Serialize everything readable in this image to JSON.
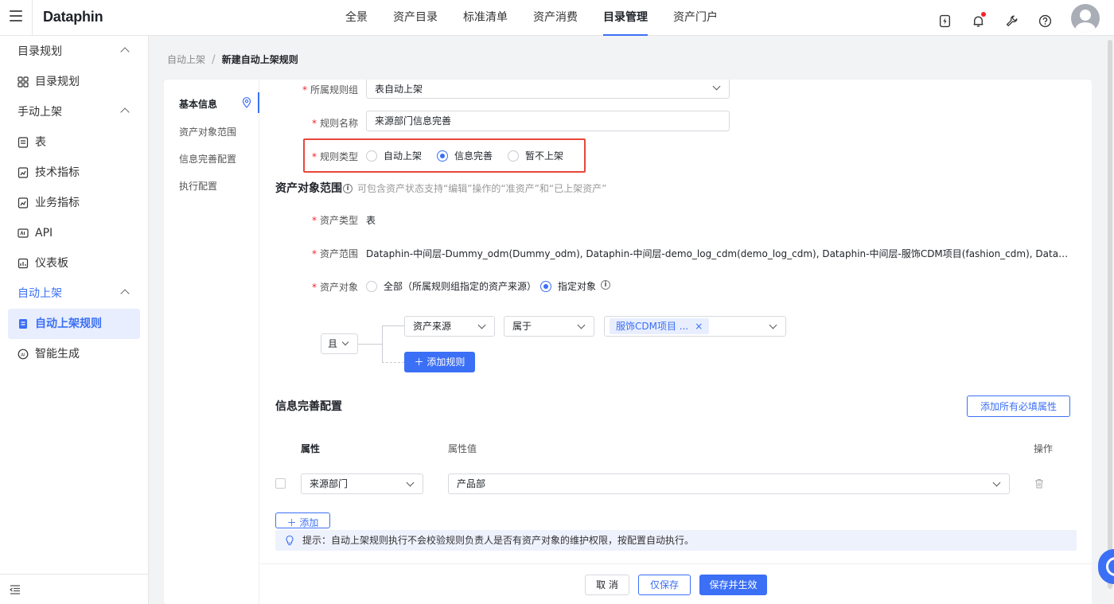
{
  "topbar": {
    "logo": "Dataphin",
    "nav": [
      {
        "label": "全景",
        "active": false
      },
      {
        "label": "资产目录",
        "active": false
      },
      {
        "label": "标准清单",
        "active": false
      },
      {
        "label": "资产消费",
        "active": false
      },
      {
        "label": "目录管理",
        "active": true
      },
      {
        "label": "资产门户",
        "active": false
      }
    ],
    "icons": [
      "energy-icon",
      "bell-icon",
      "wrench-icon",
      "help-icon",
      "avatar"
    ],
    "accent": "#3b6ff5"
  },
  "sidebar": {
    "groups": [
      {
        "label": "目录规划",
        "items": [
          "目录规划"
        ]
      },
      {
        "label": "手动上架",
        "items": [
          "表",
          "技术指标",
          "业务指标",
          "API",
          "仪表板"
        ]
      },
      {
        "label": "自动上架",
        "items": [
          "自动上架规则",
          "智能生成"
        ]
      }
    ],
    "g0": "目录规划",
    "g0_i0": "目录规划",
    "g1": "手动上架",
    "g1_i0": "表",
    "g1_i1": "技术指标",
    "g1_i2": "业务指标",
    "g1_i3": "API",
    "g1_i4": "仪表板",
    "g2": "自动上架",
    "g2_i0": "自动上架规则",
    "g2_i1": "智能生成"
  },
  "breadcrumb": {
    "parent": "自动上架",
    "separator": "/",
    "current": "新建自动上架规则"
  },
  "anchor": {
    "items": [
      "基本信息",
      "资产对象范围",
      "信息完善配置",
      "执行配置"
    ],
    "a0": "基本信息",
    "a1": "资产对象范围",
    "a2": "信息完善配置",
    "a3": "执行配置"
  },
  "basic": {
    "group_label": "所属规则组",
    "group_value": "表自动上架",
    "name_label": "规则名称",
    "name_value": "来源部门信息完善",
    "type_label": "规则类型",
    "type_options": [
      "自动上架",
      "信息完善",
      "暂不上架"
    ],
    "type_o0": "自动上架",
    "type_o1": "信息完善",
    "type_o2": "暂不上架",
    "type_selected": "信息完善"
  },
  "scope": {
    "title": "资产对象范围",
    "hint": "可包含资产状态支持“编辑”操作的“准资产”和“已上架资产”",
    "asset_type_label": "资产类型",
    "asset_type_value": "表",
    "asset_range_label": "资产范围",
    "asset_range_value": "Dataphin-中间层-Dummy_odm(Dummy_odm), Dataphin-中间层-demo_log_cdm(demo_log_cdm), Dataphin-中间层-服饰CDM项目(fashion_cdm), Dataphin-中间层-标签平台...",
    "asset_object_label": "资产对象",
    "object_options": [
      "全部（所属规则组指定的资产来源）",
      "指定对象"
    ],
    "obj_o0": "全部（所属规则组指定的资产来源）",
    "obj_o1": "指定对象",
    "object_selected": "指定对象",
    "logic": "且",
    "condition": {
      "field": "资产来源",
      "operator": "属于",
      "tag": "服饰CDM项目 ..."
    },
    "add_rule": "添加规则"
  },
  "info": {
    "title": "信息完善配置",
    "add_required": "添加所有必填属性",
    "col_attr": "属性",
    "col_value": "属性值",
    "col_action": "操作",
    "row": {
      "attr": "来源部门",
      "value": "产品部"
    },
    "add_btn": "添加"
  },
  "tip": "提示：自动上架规则执行不会校验规则负责人是否有资产对象的维护权限，按配置自动执行。",
  "footer": {
    "cancel": "取 消",
    "save_only": "仅保存",
    "save_apply": "保存并生效"
  }
}
